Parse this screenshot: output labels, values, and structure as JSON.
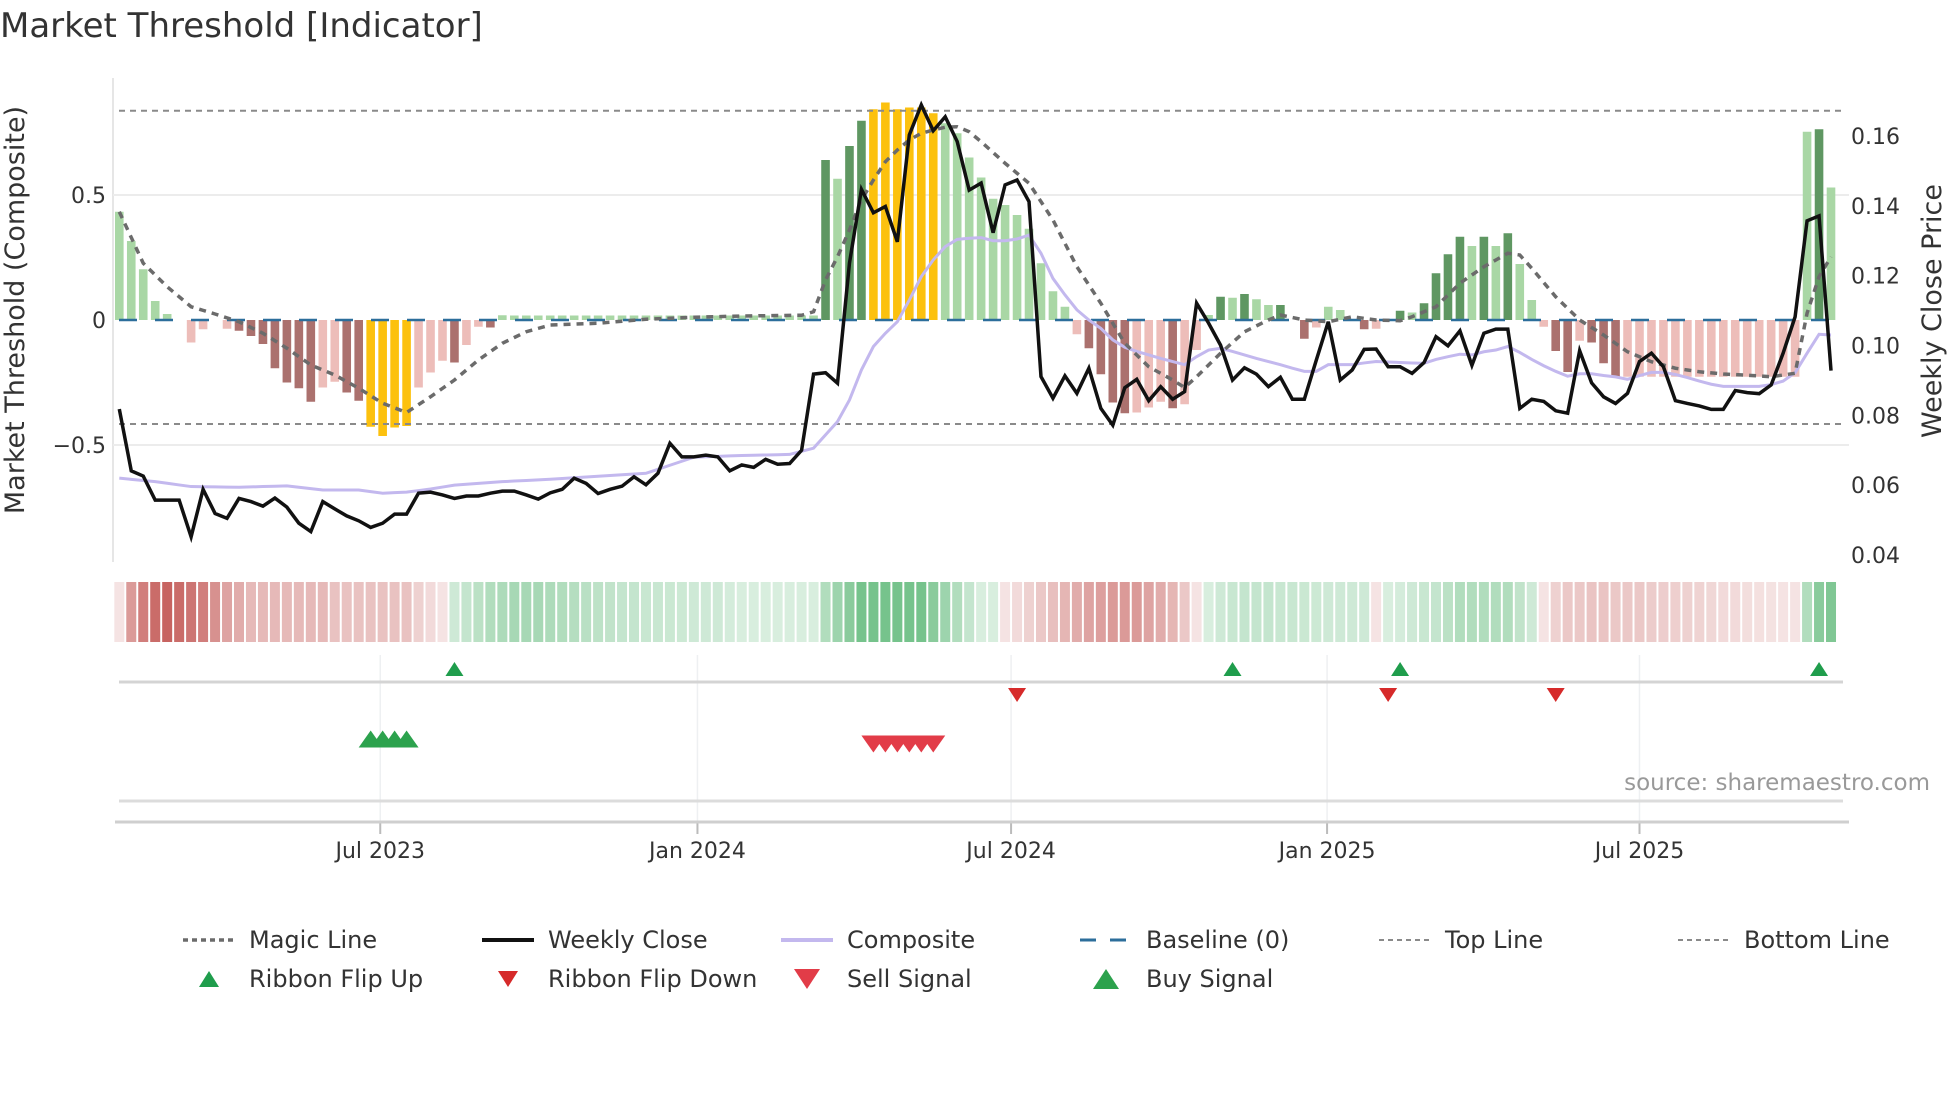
{
  "title": "Market Threshold [Indicator]",
  "source": "source: sharemaestro.com",
  "chart_data": {
    "type": "bar",
    "title": "Market Threshold [Indicator]",
    "ylabel_left": "Market Threshold (Composite)",
    "ylabel_right": "Weekly Close Price",
    "ylim_left": [
      -0.97,
      0.97
    ],
    "ylim_right": [
      0.038,
      0.1766
    ],
    "left_ticks": [
      {
        "v": 0.5,
        "label": "0.5"
      },
      {
        "v": 0,
        "label": "0"
      },
      {
        "v": -0.5,
        "label": "−0.5"
      }
    ],
    "right_ticks": [
      {
        "v": 0.16,
        "label": "0.16"
      },
      {
        "v": 0.14,
        "label": "0.14"
      },
      {
        "v": 0.12,
        "label": "0.12"
      },
      {
        "v": 0.1,
        "label": "0.10"
      },
      {
        "v": 0.08,
        "label": "0.08"
      },
      {
        "v": 0.06,
        "label": "0.06"
      },
      {
        "v": 0.04,
        "label": "0.04"
      }
    ],
    "x_ticks": [
      {
        "week": 21.8,
        "label": "Jul 2023"
      },
      {
        "week": 48.3,
        "label": "Jan 2024"
      },
      {
        "week": 74.5,
        "label": "Jul 2024"
      },
      {
        "week": 100.9,
        "label": "Jan 2025"
      },
      {
        "week": 127.0,
        "label": "Jul 2025"
      }
    ],
    "top_line": 0.837,
    "bottom_line": -0.416,
    "baseline": 0,
    "bar_colors": {
      "L": "#a9d7a5",
      "G": "#5f9762",
      "P": "#edbdb9",
      "R": "#ab716e",
      "Y": "#fcc10e"
    },
    "composite_bars": [
      0.433,
      0.316,
      0.203,
      0.076,
      0.024,
      0,
      -0.09,
      -0.037,
      0,
      -0.035,
      -0.043,
      -0.064,
      -0.096,
      -0.193,
      -0.25,
      -0.273,
      -0.327,
      -0.27,
      -0.247,
      -0.29,
      -0.323,
      -0.427,
      -0.464,
      -0.43,
      -0.424,
      -0.27,
      -0.21,
      -0.163,
      -0.17,
      -0.1,
      -0.027,
      -0.03,
      0.019,
      0.018,
      0.018,
      0.018,
      0.018,
      0.018,
      0.018,
      0.018,
      0.018,
      0.018,
      0.018,
      0.018,
      0.018,
      0.018,
      0.018,
      0.018,
      0.018,
      0.018,
      0.018,
      0.018,
      0.018,
      0.018,
      0.018,
      0.018,
      0.018,
      0.018,
      0.018,
      0.64,
      0.565,
      0.696,
      0.797,
      0.843,
      0.87,
      0.843,
      0.85,
      0.85,
      0.827,
      0.787,
      0.747,
      0.65,
      0.57,
      0.485,
      0.46,
      0.42,
      0.365,
      0.227,
      0.115,
      0.053,
      -0.057,
      -0.113,
      -0.217,
      -0.33,
      -0.373,
      -0.37,
      -0.35,
      -0.327,
      -0.353,
      -0.337,
      -0.12,
      0.02,
      0.093,
      0.089,
      0.104,
      0.083,
      0.06,
      0.06,
      0,
      -0.075,
      -0.03,
      0.053,
      0.04,
      0,
      -0.037,
      -0.035,
      0,
      0.037,
      0.03,
      0.067,
      0.187,
      0.263,
      0.333,
      0.296,
      0.333,
      0.296,
      0.347,
      0.224,
      0.08,
      -0.027,
      -0.124,
      -0.208,
      -0.083,
      -0.09,
      -0.173,
      -0.23,
      -0.227,
      -0.227,
      -0.227,
      -0.227,
      -0.227,
      -0.227,
      -0.227,
      -0.227,
      -0.227,
      -0.227,
      -0.227,
      -0.227,
      -0.227,
      -0.227,
      -0.227,
      0.753,
      0.763,
      0.53
    ],
    "bar_shades": "LLLLLLPPLPRRRRRRRPPRRYYYYPPPRPPRLLLLLLLLLLLLLLLLLLLLLLLLLLLGLGGYYYYYYLLLLLLLLLLLPRRRRPPPRPPLGLGLLGRRPLLRRPRGLGGGGLGLGLLPRRPRRRPPPPPPPPPPPPPPPLGL",
    "weekly_close": [
      0.0818,
      0.0641,
      0.0626,
      0.0557,
      0.0557,
      0.0557,
      0.0452,
      0.0588,
      0.0519,
      0.0505,
      0.0562,
      0.0553,
      0.054,
      0.0563,
      0.0537,
      0.0491,
      0.0467,
      0.0553,
      0.0532,
      0.0512,
      0.0498,
      0.0479,
      0.0491,
      0.0517,
      0.0517,
      0.0577,
      0.058,
      0.0572,
      0.0562,
      0.0569,
      0.0569,
      0.0577,
      0.0583,
      0.0583,
      0.0572,
      0.056,
      0.0578,
      0.0588,
      0.062,
      0.0605,
      0.0576,
      0.0588,
      0.0597,
      0.0624,
      0.0601,
      0.0634,
      0.072,
      0.0681,
      0.0681,
      0.0686,
      0.0681,
      0.0641,
      0.0658,
      0.0651,
      0.0674,
      0.066,
      0.0662,
      0.07,
      0.0918,
      0.0922,
      0.0892,
      0.1236,
      0.1447,
      0.138,
      0.1398,
      0.1297,
      0.1603,
      0.1689,
      0.1615,
      0.1655,
      0.1584,
      0.1445,
      0.1465,
      0.1323,
      0.146,
      0.1474,
      0.1412,
      0.0911,
      0.0849,
      0.0913,
      0.0863,
      0.0935,
      0.082,
      0.0772,
      0.0879,
      0.0903,
      0.0842,
      0.0882,
      0.0846,
      0.0868,
      0.1121,
      0.1064,
      0.1001,
      0.0901,
      0.0936,
      0.0918,
      0.0882,
      0.0909,
      0.0846,
      0.0846,
      0.0958,
      0.1068,
      0.0901,
      0.093,
      0.0989,
      0.099,
      0.0939,
      0.0939,
      0.092,
      0.0951,
      0.1025,
      0.0999,
      0.1042,
      0.0943,
      0.1035,
      0.1047,
      0.1047,
      0.082,
      0.0846,
      0.084,
      0.0813,
      0.0806,
      0.0985,
      0.0893,
      0.0853,
      0.0834,
      0.0863,
      0.0954,
      0.0978,
      0.0939,
      0.0842,
      0.0834,
      0.0827,
      0.0817,
      0.0817,
      0.0871,
      0.0865,
      0.0862,
      0.0887,
      0.0978,
      0.1082,
      0.1357,
      0.1371,
      0.0928
    ],
    "composite_line_points": [
      [
        0,
        0.062
      ],
      [
        3,
        0.061
      ],
      [
        6,
        0.0596
      ],
      [
        10,
        0.0594
      ],
      [
        14,
        0.0598
      ],
      [
        17,
        0.0586
      ],
      [
        20,
        0.0586
      ],
      [
        22,
        0.0577
      ],
      [
        24,
        0.058
      ],
      [
        26,
        0.0589
      ],
      [
        28,
        0.06
      ],
      [
        32,
        0.061
      ],
      [
        36,
        0.0617
      ],
      [
        44,
        0.0634
      ],
      [
        48,
        0.068
      ],
      [
        52,
        0.0685
      ],
      [
        56,
        0.0688
      ],
      [
        58,
        0.0706
      ],
      [
        59,
        0.0744
      ],
      [
        60,
        0.0782
      ],
      [
        61,
        0.0844
      ],
      [
        62,
        0.093
      ],
      [
        63,
        0.0997
      ],
      [
        64,
        0.1035
      ],
      [
        65,
        0.1068
      ],
      [
        66,
        0.113
      ],
      [
        67,
        0.1197
      ],
      [
        68,
        0.1245
      ],
      [
        69,
        0.1283
      ],
      [
        70,
        0.1304
      ],
      [
        71,
        0.1307
      ],
      [
        72,
        0.1309
      ],
      [
        73,
        0.13
      ],
      [
        74,
        0.13
      ],
      [
        75,
        0.1305
      ],
      [
        76,
        0.1316
      ],
      [
        77,
        0.1264
      ],
      [
        78,
        0.1192
      ],
      [
        79,
        0.1145
      ],
      [
        80,
        0.1102
      ],
      [
        81,
        0.1073
      ],
      [
        82,
        0.1049
      ],
      [
        83,
        0.1016
      ],
      [
        84,
        0.0995
      ],
      [
        85,
        0.0983
      ],
      [
        86,
        0.0973
      ],
      [
        87,
        0.0963
      ],
      [
        88,
        0.0954
      ],
      [
        89,
        0.0945
      ],
      [
        90,
        0.0968
      ],
      [
        91,
        0.0987
      ],
      [
        92,
        0.0992
      ],
      [
        93,
        0.0983
      ],
      [
        94,
        0.0973
      ],
      [
        95,
        0.0963
      ],
      [
        96,
        0.0954
      ],
      [
        97,
        0.0945
      ],
      [
        98,
        0.0935
      ],
      [
        99,
        0.0926
      ],
      [
        100,
        0.0926
      ],
      [
        101,
        0.0945
      ],
      [
        103,
        0.0945
      ],
      [
        104,
        0.095
      ],
      [
        105,
        0.0954
      ],
      [
        108,
        0.095
      ],
      [
        109,
        0.0949
      ],
      [
        110,
        0.096
      ],
      [
        111,
        0.0968
      ],
      [
        112,
        0.0975
      ],
      [
        113,
        0.0973
      ],
      [
        114,
        0.0982
      ],
      [
        115,
        0.0987
      ],
      [
        116,
        0.0997
      ],
      [
        117,
        0.098
      ],
      [
        118,
        0.096
      ],
      [
        119,
        0.0942
      ],
      [
        120,
        0.0926
      ],
      [
        121,
        0.0912
      ],
      [
        122,
        0.0919
      ],
      [
        123,
        0.0919
      ],
      [
        124,
        0.0914
      ],
      [
        125,
        0.091
      ],
      [
        126,
        0.0903
      ],
      [
        127,
        0.0914
      ],
      [
        128,
        0.0923
      ],
      [
        129,
        0.0923
      ],
      [
        130,
        0.0917
      ],
      [
        131,
        0.0908
      ],
      [
        132,
        0.0898
      ],
      [
        133,
        0.0889
      ],
      [
        134,
        0.0883
      ],
      [
        137,
        0.0883
      ],
      [
        138,
        0.0888
      ],
      [
        139,
        0.0898
      ],
      [
        140,
        0.0922
      ],
      [
        141,
        0.0978
      ],
      [
        142,
        0.1032
      ],
      [
        143,
        0.103
      ]
    ],
    "magic_line_points": [
      [
        0,
        0.433
      ],
      [
        2,
        0.227
      ],
      [
        4,
        0.133
      ],
      [
        6,
        0.053
      ],
      [
        8,
        0.024
      ],
      [
        10,
        -0.007
      ],
      [
        12,
        -0.053
      ],
      [
        14,
        -0.113
      ],
      [
        16,
        -0.18
      ],
      [
        18,
        -0.22
      ],
      [
        20,
        -0.273
      ],
      [
        22,
        -0.333
      ],
      [
        24,
        -0.37
      ],
      [
        26,
        -0.307
      ],
      [
        28,
        -0.24
      ],
      [
        30,
        -0.16
      ],
      [
        32,
        -0.093
      ],
      [
        34,
        -0.047
      ],
      [
        36,
        -0.02
      ],
      [
        40,
        -0.013
      ],
      [
        44,
        0.003
      ],
      [
        48,
        0.011
      ],
      [
        52,
        0.016
      ],
      [
        57,
        0.019
      ],
      [
        58,
        0.033
      ],
      [
        59,
        0.16
      ],
      [
        60,
        0.253
      ],
      [
        61,
        0.36
      ],
      [
        62,
        0.48
      ],
      [
        63,
        0.56
      ],
      [
        64,
        0.633
      ],
      [
        65,
        0.68
      ],
      [
        66,
        0.72
      ],
      [
        67,
        0.747
      ],
      [
        68,
        0.76
      ],
      [
        69,
        0.771
      ],
      [
        70,
        0.773
      ],
      [
        71,
        0.753
      ],
      [
        72,
        0.713
      ],
      [
        74,
        0.627
      ],
      [
        76,
        0.547
      ],
      [
        78,
        0.4
      ],
      [
        80,
        0.213
      ],
      [
        82,
        0.067
      ],
      [
        84,
        -0.093
      ],
      [
        86,
        -0.187
      ],
      [
        88,
        -0.24
      ],
      [
        89,
        -0.27
      ],
      [
        90,
        -0.227
      ],
      [
        92,
        -0.133
      ],
      [
        94,
        -0.047
      ],
      [
        96,
        0
      ],
      [
        97,
        0.02
      ],
      [
        99,
        0
      ],
      [
        101,
        -0.007
      ],
      [
        103,
        0.013
      ],
      [
        105,
        0
      ],
      [
        107,
        -0.003
      ],
      [
        108,
        0.013
      ],
      [
        110,
        0.053
      ],
      [
        112,
        0.147
      ],
      [
        114,
        0.213
      ],
      [
        116,
        0.267
      ],
      [
        117,
        0.26
      ],
      [
        118,
        0.207
      ],
      [
        120,
        0.093
      ],
      [
        122,
        0
      ],
      [
        124,
        -0.06
      ],
      [
        126,
        -0.127
      ],
      [
        128,
        -0.167
      ],
      [
        130,
        -0.193
      ],
      [
        132,
        -0.207
      ],
      [
        134,
        -0.216
      ],
      [
        136,
        -0.221
      ],
      [
        138,
        -0.227
      ],
      [
        140,
        -0.213
      ],
      [
        141,
        0.027
      ],
      [
        142,
        0.173
      ],
      [
        143,
        0.253
      ]
    ],
    "ribbon": [
      -0.15,
      -0.55,
      -0.7,
      -0.8,
      -0.85,
      -0.8,
      -0.75,
      -0.7,
      -0.6,
      -0.5,
      -0.45,
      -0.38,
      -0.38,
      -0.38,
      -0.38,
      -0.38,
      -0.38,
      -0.38,
      -0.33,
      -0.33,
      -0.33,
      -0.33,
      -0.33,
      -0.33,
      -0.33,
      -0.25,
      -0.2,
      -0.15,
      0.25,
      0.3,
      0.35,
      0.4,
      0.42,
      0.45,
      0.45,
      0.45,
      0.42,
      0.4,
      0.38,
      0.36,
      0.34,
      0.32,
      0.3,
      0.3,
      0.28,
      0.28,
      0.27,
      0.26,
      0.25,
      0.25,
      0.25,
      0.22,
      0.2,
      0.2,
      0.2,
      0.2,
      0.2,
      0.2,
      0.2,
      0.4,
      0.5,
      0.6,
      0.7,
      0.7,
      0.7,
      0.7,
      0.7,
      0.7,
      0.6,
      0.5,
      0.4,
      0.3,
      0.2,
      0.2,
      -0.15,
      -0.2,
      -0.25,
      -0.3,
      -0.35,
      -0.4,
      -0.45,
      -0.5,
      -0.52,
      -0.55,
      -0.55,
      -0.55,
      -0.5,
      -0.45,
      -0.4,
      -0.3,
      -0.15,
      0.2,
      0.25,
      0.28,
      0.3,
      0.3,
      0.3,
      0.28,
      0.28,
      0.27,
      0.26,
      0.25,
      0.25,
      0.25,
      0.25,
      -0.15,
      0.2,
      0.22,
      0.25,
      0.28,
      0.3,
      0.35,
      0.4,
      0.4,
      0.4,
      0.4,
      0.4,
      0.32,
      0.25,
      -0.15,
      -0.25,
      -0.3,
      -0.3,
      -0.32,
      -0.32,
      -0.3,
      -0.3,
      -0.3,
      -0.28,
      -0.27,
      -0.26,
      -0.25,
      -0.24,
      -0.22,
      -0.2,
      -0.2,
      -0.18,
      -0.17,
      -0.16,
      -0.15,
      -0.15,
      0.4,
      0.6,
      0.65
    ],
    "ribbon_flip_up_weeks": [
      28,
      93,
      107,
      142
    ],
    "ribbon_flip_down_weeks": [
      75,
      106,
      120
    ],
    "buy_signal_weeks": [
      21,
      22,
      23,
      24
    ],
    "sell_signal_weeks": [
      63,
      64,
      65,
      66,
      67,
      68
    ],
    "colors": {
      "close": "#111111",
      "composite": "#c3b8ee",
      "magic": "#6b6b6b",
      "baseline": "#2c6e9b",
      "refline": "#8a8a8a",
      "up": "#1f9d4c",
      "down": "#d62a2a",
      "buy": "#2ca24d",
      "sell": "#e23c48",
      "ribbon_red": "#c0504d",
      "ribbon_green": "#45ad62"
    },
    "legend": [
      {
        "label": "Magic Line",
        "symbol": "magic"
      },
      {
        "label": "Weekly Close",
        "symbol": "close"
      },
      {
        "label": "Composite",
        "symbol": "composite"
      },
      {
        "label": "Baseline (0)",
        "symbol": "baseline"
      },
      {
        "label": "Top Line",
        "symbol": "refline"
      },
      {
        "label": "Bottom Line",
        "symbol": "refline"
      },
      {
        "label": "Ribbon Flip Up",
        "symbol": "up"
      },
      {
        "label": "Ribbon Flip Down",
        "symbol": "down"
      },
      {
        "label": "Sell Signal",
        "symbol": "sell"
      },
      {
        "label": "Buy Signal",
        "symbol": "buy"
      }
    ]
  }
}
